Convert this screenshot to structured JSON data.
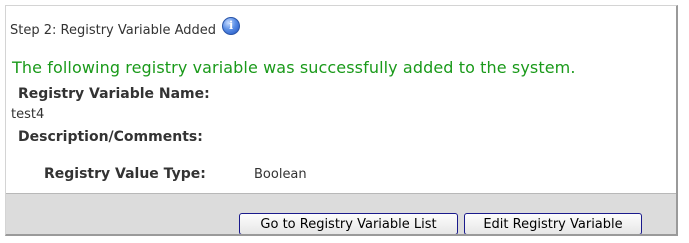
{
  "step": {
    "title": "Step 2: Registry Variable Added",
    "info_icon": "info-icon",
    "info_glyph": "i"
  },
  "message": {
    "success": "The following registry variable was successfully added to the system.",
    "success_color": "#1a9a1a"
  },
  "fields": {
    "name_label": "Registry Variable Name:",
    "name_value": "test4",
    "description_label": "Description/Comments:",
    "description_value": "",
    "type_label": "Registry Value Type:",
    "type_value": "Boolean"
  },
  "actions": {
    "list_button": "Go to Registry Variable List",
    "edit_button": "Edit Registry Variable"
  }
}
